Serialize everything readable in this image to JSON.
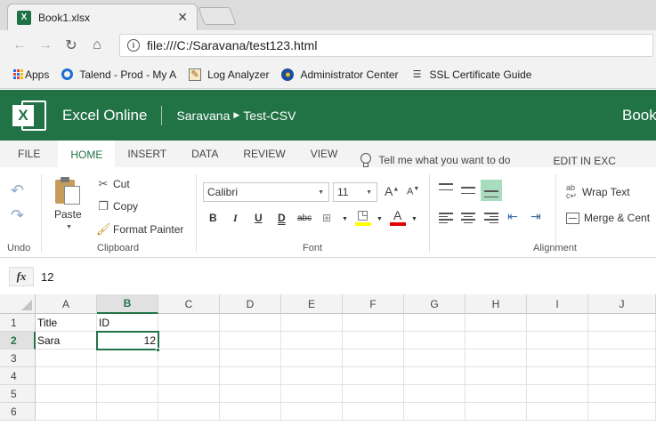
{
  "browser": {
    "tab_title": "Book1.xlsx",
    "tab_icon_letter": "X",
    "close_glyph": "✕",
    "url": "file:///C:/Saravana/test123.html",
    "bookmarks": [
      {
        "label": "Apps",
        "icon": "apps-grid-icon"
      },
      {
        "label": "Talend - Prod - My A",
        "icon": "talend-icon"
      },
      {
        "label": "Log Analyzer",
        "icon": "log-analyzer-icon"
      },
      {
        "label": "Administrator Center",
        "icon": "admin-center-icon"
      },
      {
        "label": "SSL Certificate Guide",
        "icon": "ssl-guide-icon"
      }
    ]
  },
  "excel": {
    "app_name": "Excel Online",
    "breadcrumb_owner": "Saravana",
    "breadcrumb_folder": "Test-CSV",
    "book_cut": "Book",
    "brand_color": "#217346",
    "ribbon_tabs": [
      "FILE",
      "HOME",
      "INSERT",
      "DATA",
      "REVIEW",
      "VIEW"
    ],
    "active_tab": "HOME",
    "tell_me": "Tell me what you want to do",
    "edit_in": "EDIT IN EXC",
    "groups": {
      "undo": "Undo",
      "clipboard": "Clipboard",
      "font": "Font",
      "alignment": "Alignment"
    },
    "clipboard": {
      "paste": "Paste",
      "cut": "Cut",
      "copy": "Copy",
      "format_painter": "Format Painter"
    },
    "font": {
      "name": "Calibri",
      "size": "11",
      "bold": "B",
      "italic": "I",
      "underline": "U",
      "double_underline": "D",
      "strike": "abc"
    },
    "alignment": {
      "wrap_text": "Wrap Text",
      "merge": "Merge & Cent"
    },
    "formula_value": "12",
    "fx_label": "fx"
  },
  "grid": {
    "columns": [
      "A",
      "B",
      "C",
      "D",
      "E",
      "F",
      "G",
      "H",
      "I",
      "J"
    ],
    "selected_column": "B",
    "rows": [
      "1",
      "2",
      "3",
      "4",
      "5",
      "6"
    ],
    "selected_row": "2",
    "cells": {
      "A1": "Title",
      "B1": "ID",
      "A2": "Sara",
      "B2": "12"
    }
  }
}
